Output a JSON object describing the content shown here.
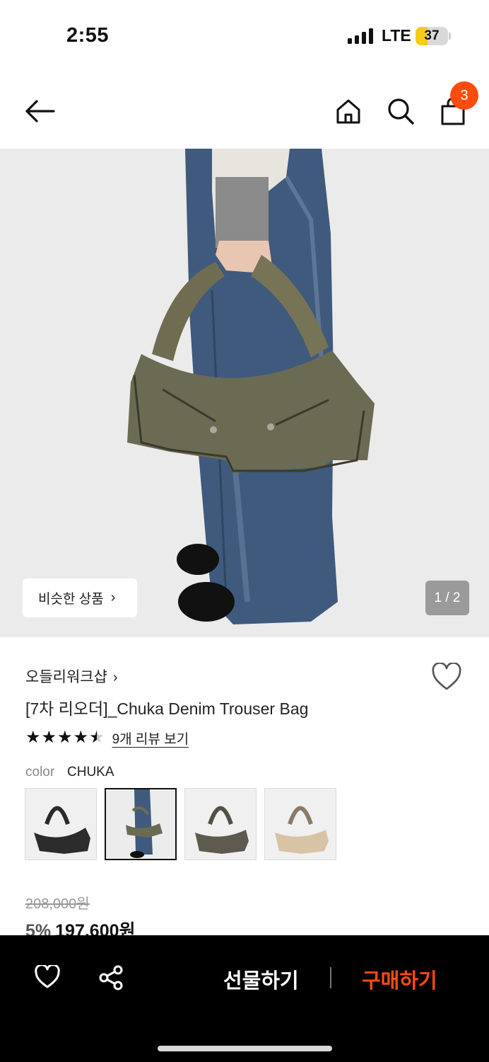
{
  "status_bar": {
    "time": "2:55",
    "network": "LTE",
    "battery": "37",
    "battery_level": 0.37
  },
  "header": {
    "back_icon": "arrow-left-icon",
    "home_icon": "home-icon",
    "search_icon": "search-icon",
    "cart_icon": "shopping-bag-icon",
    "cart_count": "3"
  },
  "hero": {
    "similar_label": "비슷한 상품",
    "chevron": "›",
    "page_indicator": "1 / 2"
  },
  "product": {
    "brand": "오들리워크샵",
    "brand_chevron": "›",
    "title": "[7차 리오더]_Chuka Denim Trouser Bag",
    "rating": 4.5,
    "stars": [
      "★",
      "★",
      "★",
      "★",
      "★"
    ],
    "review_link": "9개 리뷰 보기",
    "color_label": "color",
    "color_value": "CHUKA",
    "swatches": [
      "black",
      "chuka",
      "charcoal",
      "beige"
    ],
    "original_price": "208,000원",
    "discount": "5%",
    "sale_price": "197,600원"
  },
  "bottom_bar": {
    "wish_icon": "heart-icon",
    "share_icon": "share-icon",
    "gift_label": "선물하기",
    "buy_label": "구매하기"
  },
  "colors": {
    "accent": "#ff4b0d",
    "bar": "#000000",
    "hero_bg": "#ebebeb"
  }
}
